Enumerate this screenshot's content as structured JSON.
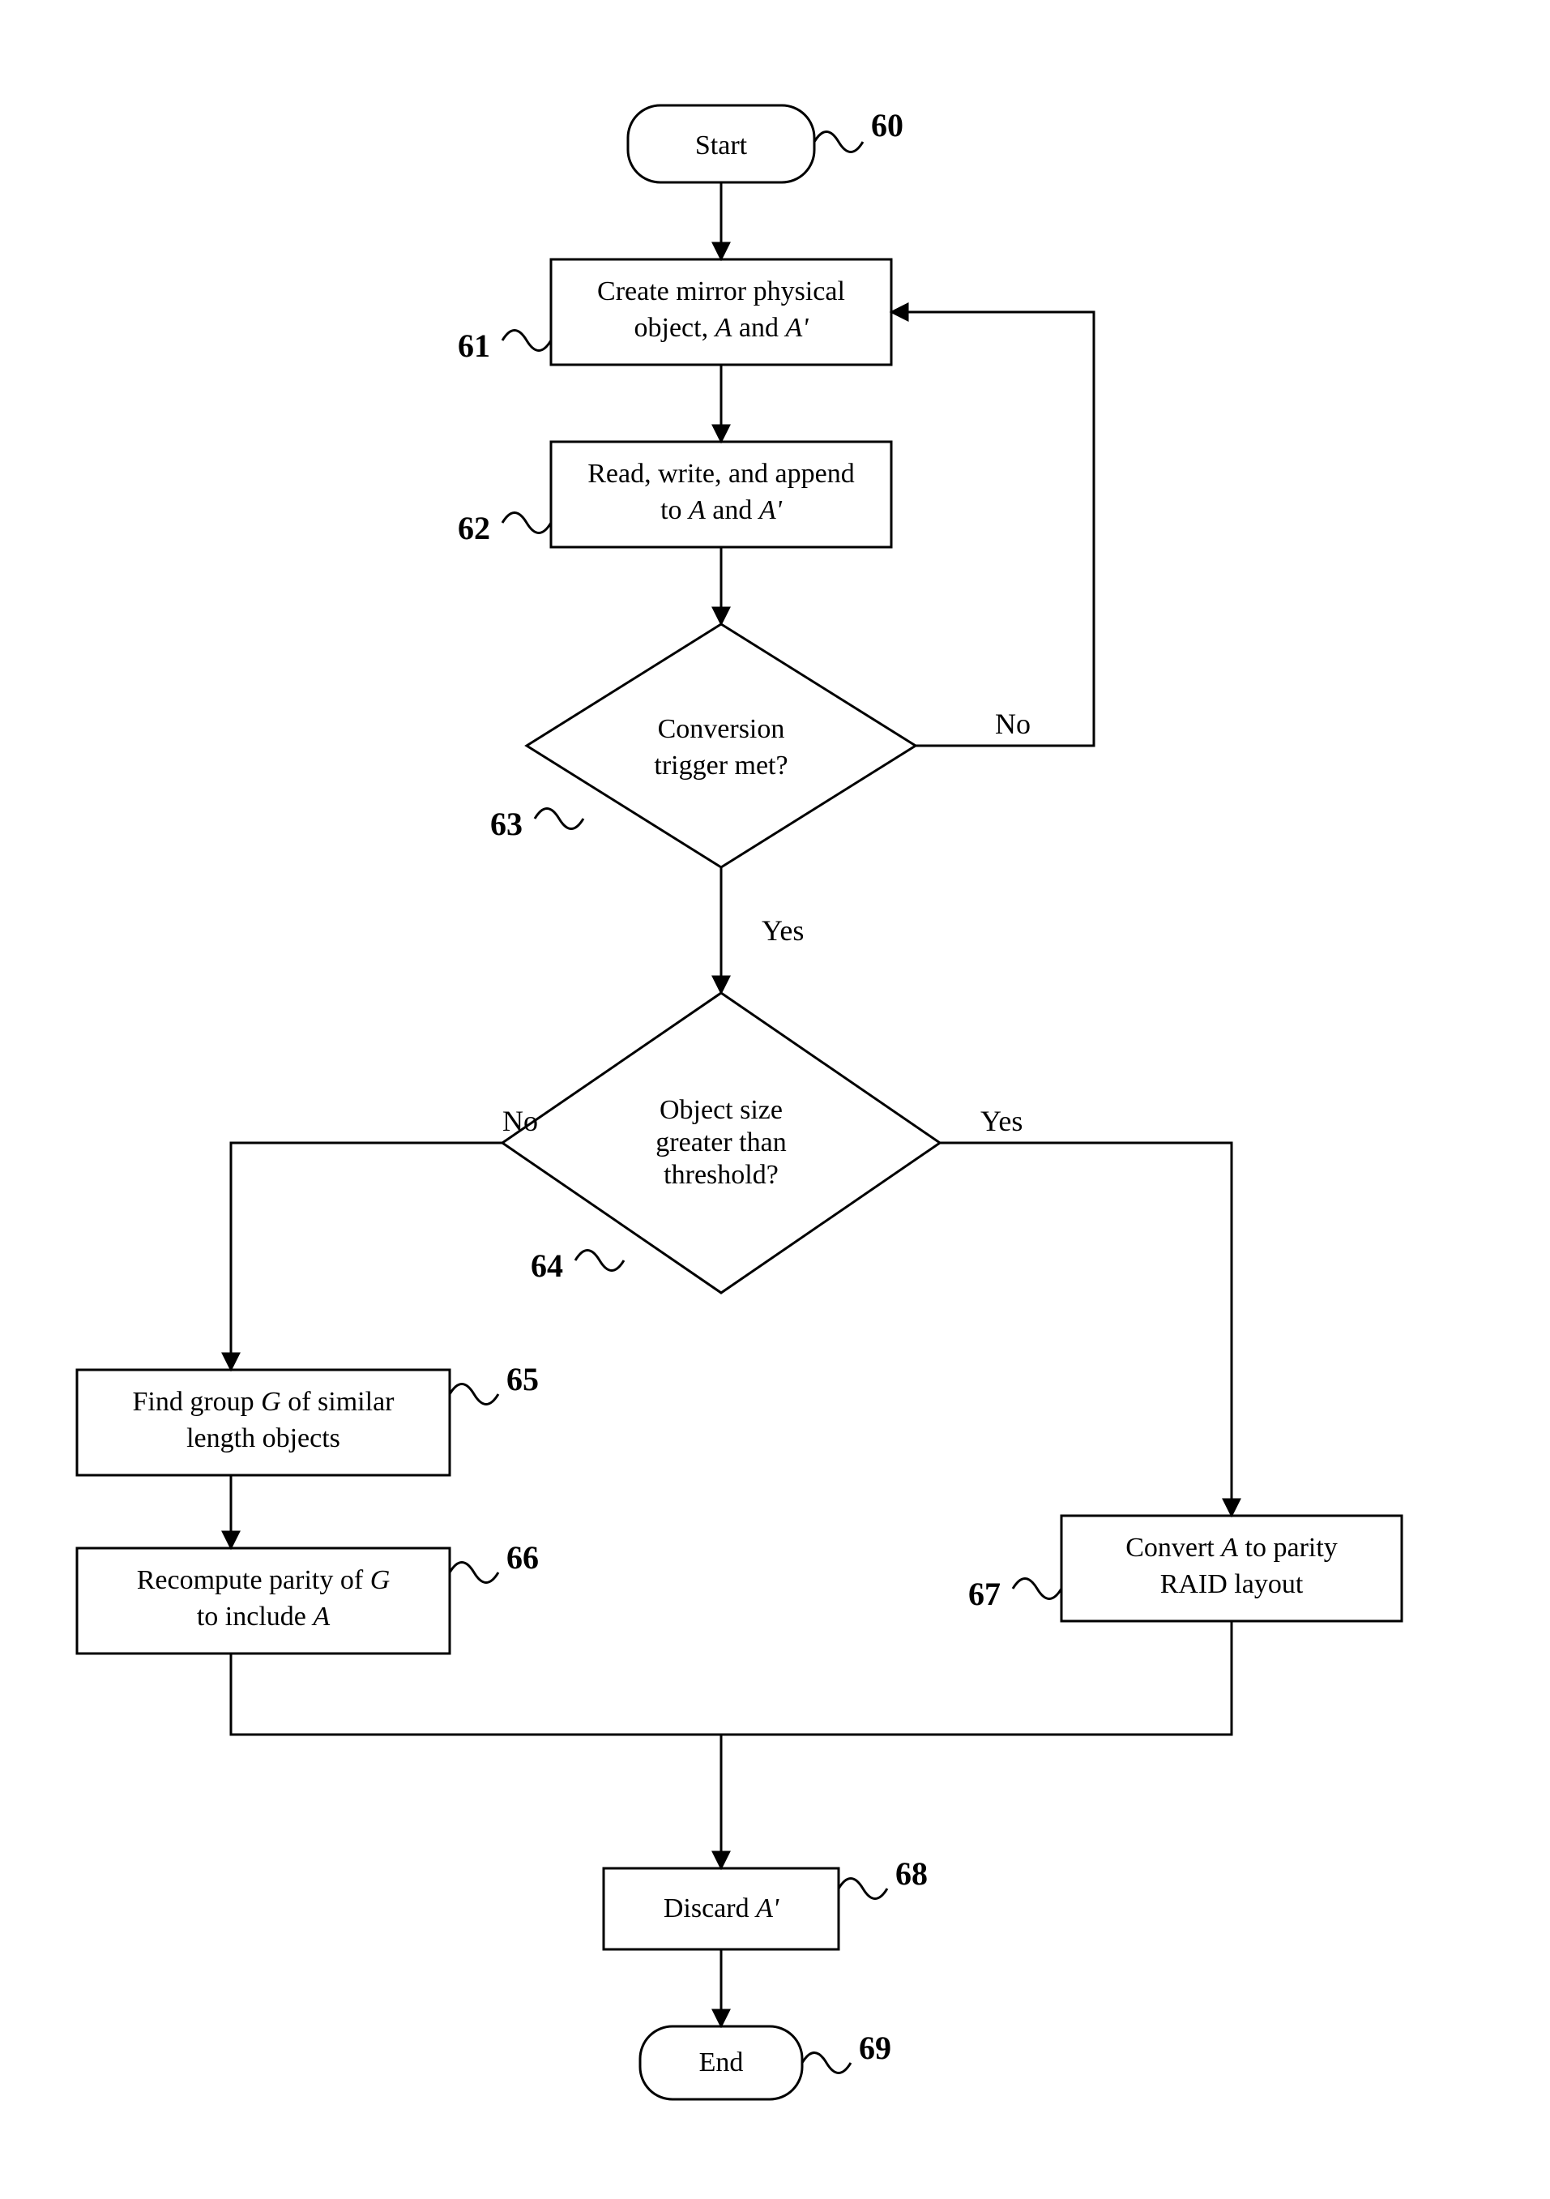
{
  "nodes": {
    "start": {
      "ref": "60",
      "text": "Start"
    },
    "create": {
      "ref": "61",
      "line1_a": "Create mirror physical",
      "line2_a": "object, ",
      "line2_b": "A",
      "line2_c": " and ",
      "line2_d": "A'"
    },
    "rw": {
      "ref": "62",
      "line1": "Read, write, and append",
      "line2_a": "to ",
      "line2_b": "A",
      "line2_c": " and ",
      "line2_d": "A'"
    },
    "trig": {
      "ref": "63",
      "line1": "Conversion",
      "line2": "trigger met?"
    },
    "size": {
      "ref": "64",
      "line1": "Object size",
      "line2": "greater than",
      "line3": "threshold?"
    },
    "find": {
      "ref": "65",
      "line1_a": "Find group ",
      "line1_b": "G",
      "line1_c": " of similar",
      "line2": "length objects"
    },
    "recompute": {
      "ref": "66",
      "line1_a": "Recompute parity of ",
      "line1_b": "G",
      "line2_a": "to include ",
      "line2_b": "A"
    },
    "convert": {
      "ref": "67",
      "line1_a": "Convert ",
      "line1_b": "A",
      "line1_c": " to parity",
      "line2": "RAID layout"
    },
    "discard": {
      "ref": "68",
      "line1_a": "Discard ",
      "line1_b": "A'"
    },
    "end": {
      "ref": "69",
      "text": "End"
    }
  },
  "labels": {
    "yes": "Yes",
    "no": "No"
  }
}
